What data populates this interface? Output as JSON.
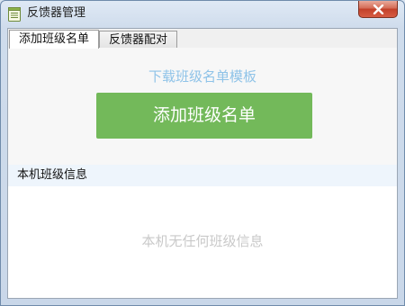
{
  "window": {
    "title": "反馈器管理",
    "icon": "notebook-icon",
    "close_icon": "close-icon"
  },
  "tabs": [
    {
      "label": "添加班级名单",
      "active": true
    },
    {
      "label": "反馈器配对",
      "active": false
    }
  ],
  "panel": {
    "download_link": "下载班级名单模板",
    "add_button": "添加班级名单",
    "section_title": "本机班级信息",
    "empty_message": "本机无任何班级信息"
  },
  "colors": {
    "accent_green": "#73b95a",
    "link_blue": "#8fc3e8",
    "section_bg": "#eef5fc",
    "close_red": "#c2412a"
  }
}
